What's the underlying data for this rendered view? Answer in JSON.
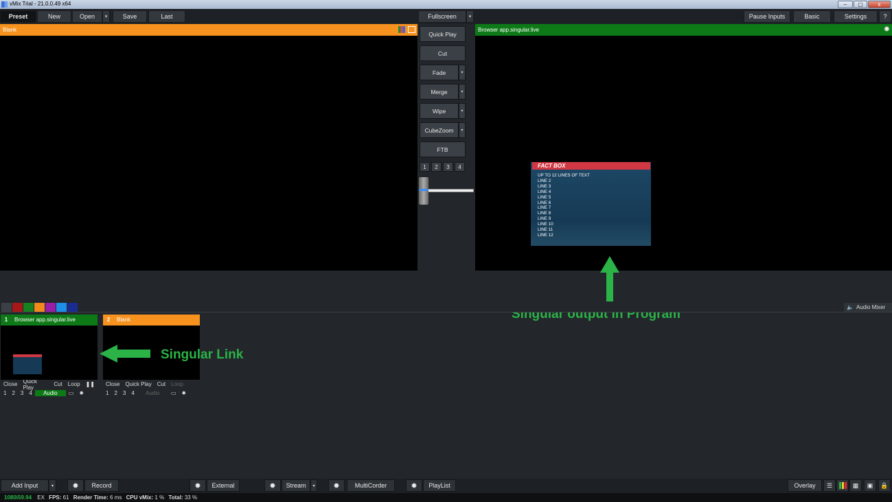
{
  "window": {
    "title": "vMix Trial - 21.0.0.49 x64",
    "min": "–",
    "max": "▢",
    "close": "x"
  },
  "toolbar": {
    "preset": "Preset",
    "new": "New",
    "open": "Open",
    "save": "Save",
    "last": "Last",
    "fullscreen": "Fullscreen",
    "pause_inputs": "Pause Inputs",
    "basic": "Basic",
    "settings": "Settings",
    "help": "?"
  },
  "preview": {
    "title": "Blank"
  },
  "program": {
    "title": "Browser app.singular.live"
  },
  "transitions": {
    "quick_play": "Quick Play",
    "cut": "Cut",
    "fade": "Fade",
    "merge": "Merge",
    "wipe": "Wipe",
    "cubezoom": "CubeZoom",
    "ftb": "FTB",
    "nums": [
      "1",
      "2",
      "3",
      "4"
    ]
  },
  "factbox": {
    "title": "FACT BOX",
    "lines": [
      "UP TO 12 LINES OF TEXT",
      "LINE 2",
      "LINE 3",
      "LINE 4",
      "LINE 5",
      "LINE 6",
      "LINE 7",
      "LINE 8",
      "LINE 9",
      "LINE 10",
      "LINE 11",
      "LINE 12"
    ]
  },
  "annotations": {
    "program": "Singular output in Program",
    "link": "Singular Link"
  },
  "audio_mixer": "Audio Mixer",
  "inputs": [
    {
      "num": "1",
      "title": "Browser app.singular.live",
      "close": "Close",
      "quick_play": "Quick Play",
      "cut": "Cut",
      "loop": "Loop",
      "audio": "Audio",
      "nums": [
        "1",
        "2",
        "3",
        "4"
      ]
    },
    {
      "num": "2",
      "title": "Blank",
      "close": "Close",
      "quick_play": "Quick Play",
      "cut": "Cut",
      "loop": "Loop",
      "audio": "Audio",
      "nums": [
        "1",
        "2",
        "3",
        "4"
      ]
    }
  ],
  "colors": {
    "accent_green": "#0d7a17",
    "accent_orange": "#f7921e",
    "annotation": "#2bb347"
  },
  "bottombar": {
    "add_input": "Add Input",
    "record": "Record",
    "external": "External",
    "stream": "Stream",
    "multicorder": "MultiCorder",
    "playlist": "PlayList",
    "overlay": "Overlay"
  },
  "status": {
    "format": "1080i59.94",
    "ex": "EX",
    "fps_label": "FPS:",
    "fps": "61",
    "render_label": "Render Time:",
    "render": "6 ms",
    "cpu_label": "CPU vMix:",
    "cpu": "1 %",
    "total_label": "Total:",
    "total": "33 %"
  }
}
